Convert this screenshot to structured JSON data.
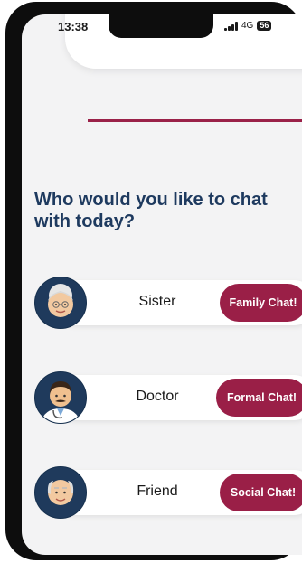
{
  "status_bar": {
    "time": "13:38",
    "network": "4G",
    "battery": "56"
  },
  "main": {
    "heading": "Who would you like to chat with today?",
    "contacts": [
      {
        "name": "Sister",
        "button_label": "Family Chat!",
        "avatar_icon": "grandmother-emoji-icon"
      },
      {
        "name": "Doctor",
        "button_label": "Formal Chat!",
        "avatar_icon": "man-doctor-emoji-icon"
      },
      {
        "name": "Friend",
        "button_label": "Social Chat!",
        "avatar_icon": "older-man-emoji-icon"
      }
    ]
  },
  "colors": {
    "accent": "#9a1f47",
    "heading": "#1e3a5f",
    "avatar_bg": "#1f3a5c",
    "background": "#f3f3f4"
  }
}
